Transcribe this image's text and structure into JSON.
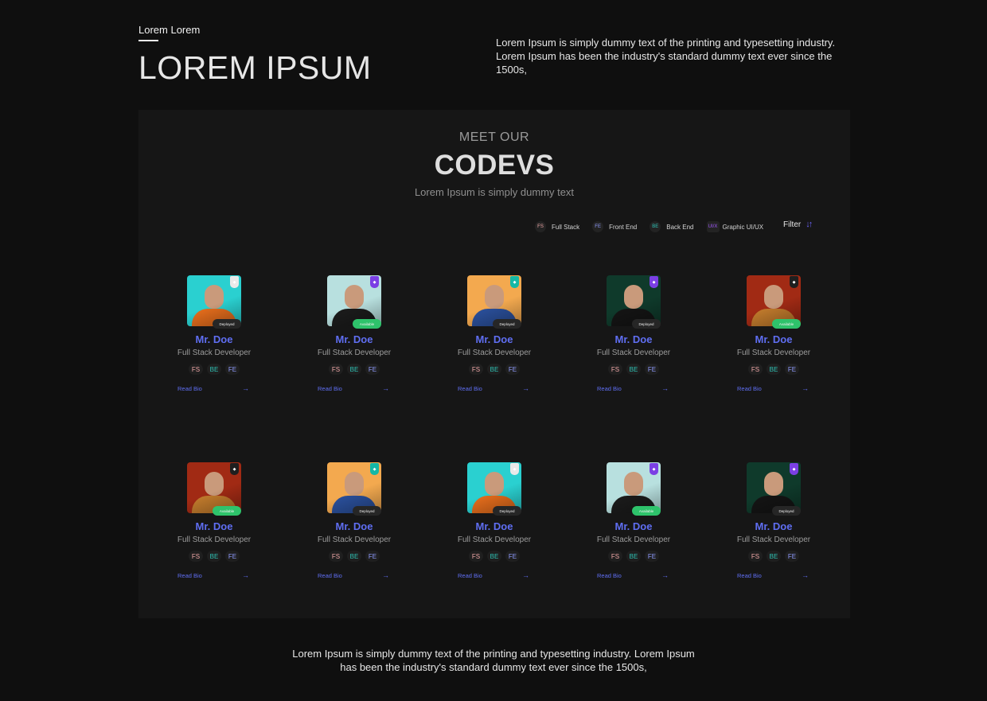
{
  "header": {
    "eyebrow": "Lorem Lorem",
    "title": "LOREM IPSUM",
    "description": "Lorem Ipsum is simply dummy text of the printing and typesetting industry. Lorem Ipsum has been the industry's standard dummy text ever since the 1500s,"
  },
  "section": {
    "kicker": "MEET OUR",
    "title": "CODEVS",
    "tagline": "Lorem Ipsum is simply dummy text"
  },
  "legend": [
    {
      "abbr": "FS",
      "label": "Full Stack",
      "color": "#f2a8a8"
    },
    {
      "abbr": "FE",
      "label": "Front End",
      "color": "#8f9bff"
    },
    {
      "abbr": "BE",
      "label": "Back End",
      "color": "#2ec4b6"
    },
    {
      "abbr": "UI/X",
      "label": "Graphic UI/UX",
      "color": "#a259ff"
    }
  ],
  "filter": {
    "label": "Filter",
    "icon": "sort-icon"
  },
  "colors": {
    "accent": "#5f6ef2",
    "available": "#2ec36b",
    "deployed": "#262626"
  },
  "cards": [
    {
      "name": "Mr. Doe",
      "role": "Full Stack Developer",
      "status": "Deployed",
      "bg": "#2ad0d0",
      "shirt": "#e36c1c",
      "rank_color": "#e9e9e9",
      "skills": [
        "FS",
        "BE",
        "FE"
      ],
      "read_bio": "Read Bio"
    },
    {
      "name": "Mr. Doe",
      "role": "Full Stack Developer",
      "status": "Available",
      "bg": "#b8e0df",
      "shirt": "#1b1b1b",
      "rank_color": "#7b3fe4",
      "skills": [
        "FS",
        "BE",
        "FE"
      ],
      "read_bio": "Read Bio"
    },
    {
      "name": "Mr. Doe",
      "role": "Full Stack Developer",
      "status": "Deployed",
      "bg": "#f3a94f",
      "shirt": "#2a4f9a",
      "rank_color": "#14b8a6",
      "skills": [
        "FS",
        "BE",
        "FE"
      ],
      "read_bio": "Read Bio"
    },
    {
      "name": "Mr. Doe",
      "role": "Full Stack Developer",
      "status": "Deployed",
      "bg": "#0f3a2b",
      "shirt": "#141414",
      "rank_color": "#7b3fe4",
      "skills": [
        "FS",
        "BE",
        "FE"
      ],
      "read_bio": "Read Bio"
    },
    {
      "name": "Mr. Doe",
      "role": "Full Stack Developer",
      "status": "Available",
      "bg": "#a12a14",
      "shirt": "#c07a2c",
      "rank_color": "#1f1f1f",
      "skills": [
        "FS",
        "BE",
        "FE"
      ],
      "read_bio": "Read Bio"
    },
    {
      "name": "Mr. Doe",
      "role": "Full Stack Developer",
      "status": "Available",
      "bg": "#a12a14",
      "shirt": "#c07a2c",
      "rank_color": "#1f1f1f",
      "skills": [
        "FS",
        "BE",
        "FE"
      ],
      "read_bio": "Read Bio"
    },
    {
      "name": "Mr. Doe",
      "role": "Full Stack Developer",
      "status": "Deployed",
      "bg": "#f3a94f",
      "shirt": "#2a4f9a",
      "rank_color": "#14b8a6",
      "skills": [
        "FS",
        "BE",
        "FE"
      ],
      "read_bio": "Read Bio"
    },
    {
      "name": "Mr. Doe",
      "role": "Full Stack Developer",
      "status": "Deployed",
      "bg": "#2ad0d0",
      "shirt": "#e36c1c",
      "rank_color": "#e9e9e9",
      "skills": [
        "FS",
        "BE",
        "FE"
      ],
      "read_bio": "Read Bio"
    },
    {
      "name": "Mr. Doe",
      "role": "Full Stack Developer",
      "status": "Available",
      "bg": "#b8e0df",
      "shirt": "#1b1b1b",
      "rank_color": "#7b3fe4",
      "skills": [
        "FS",
        "BE",
        "FE"
      ],
      "read_bio": "Read Bio"
    },
    {
      "name": "Mr. Doe",
      "role": "Full Stack Developer",
      "status": "Deployed",
      "bg": "#0f3a2b",
      "shirt": "#141414",
      "rank_color": "#7b3fe4",
      "skills": [
        "FS",
        "BE",
        "FE"
      ],
      "read_bio": "Read Bio"
    }
  ],
  "footer": {
    "text": "Lorem Ipsum is simply dummy text of the printing and typesetting industry. Lorem Ipsum has been the industry's standard dummy text ever since the 1500s,"
  }
}
